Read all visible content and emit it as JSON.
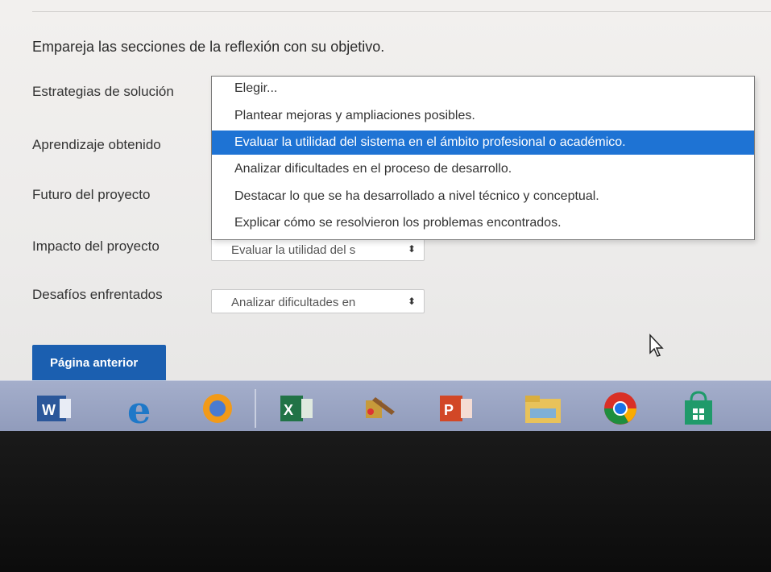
{
  "question": "Empareja las secciones de la reflexión con su objetivo.",
  "rows": [
    {
      "label": "Estrategias de solución"
    },
    {
      "label": "Aprendizaje obtenido"
    },
    {
      "label": "Futuro del proyecto"
    },
    {
      "label": "Impacto del proyecto",
      "value": "Evaluar la utilidad del s"
    },
    {
      "label": "Desafíos enfrentados",
      "value": "Analizar dificultades en"
    }
  ],
  "dropdown": {
    "options": [
      "Elegir...",
      "Plantear mejoras y ampliaciones posibles.",
      "Evaluar la utilidad del sistema en el ámbito profesional o académico.",
      "Analizar dificultades en el proceso de desarrollo.",
      "Destacar lo que se ha desarrollado a nivel técnico y conceptual.",
      "Explicar cómo se resolvieron los problemas encontrados."
    ],
    "selected_index": 2
  },
  "select_arrow": "⬍",
  "prev_button": "Página anterior",
  "taskbar": [
    "word-icon",
    "edge-icon",
    "cortana-icon",
    "excel-icon",
    "paint-icon",
    "powerpoint-icon",
    "explorer-icon",
    "chrome-icon",
    "store-icon"
  ],
  "colors": {
    "accent": "#1e73d4",
    "button": "#1b5fb0",
    "taskbar": "#98a3c2"
  }
}
